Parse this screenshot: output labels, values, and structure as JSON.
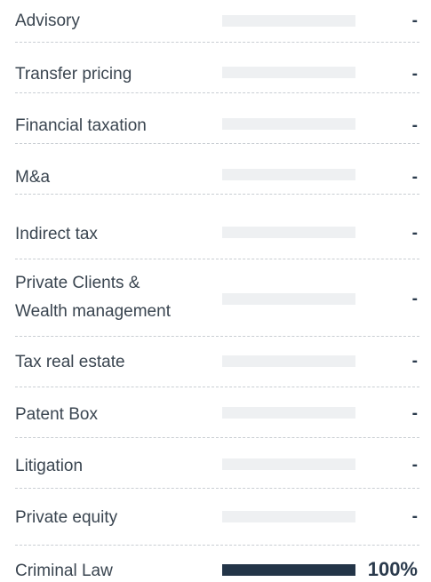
{
  "services": [
    {
      "label": "Advisory",
      "value_text": "-",
      "fill": 0
    },
    {
      "label": "Transfer pricing",
      "value_text": "-",
      "fill": 0
    },
    {
      "label": "Financial taxation",
      "value_text": "-",
      "fill": 0
    },
    {
      "label": "M&a",
      "value_text": "-",
      "fill": 0
    },
    {
      "label": "Indirect tax",
      "value_text": "-",
      "fill": 0
    },
    {
      "label_line1": "Private Clients &",
      "label_line2": "Wealth management",
      "value_text": "-",
      "fill": 0
    },
    {
      "label": "Tax real estate",
      "value_text": "-",
      "fill": 0
    },
    {
      "label": "Patent Box",
      "value_text": "-",
      "fill": 0
    },
    {
      "label": "Litigation",
      "value_text": "-",
      "fill": 0
    },
    {
      "label": "Private equity",
      "value_text": "-",
      "fill": 0
    },
    {
      "label": "Criminal Law",
      "value_text": "100%",
      "fill": 1.0
    }
  ],
  "colors": {
    "text": "#3a4550",
    "bar_track": "#eef0f2",
    "bar_fill": "#233548",
    "divider": "#c9ced3"
  }
}
